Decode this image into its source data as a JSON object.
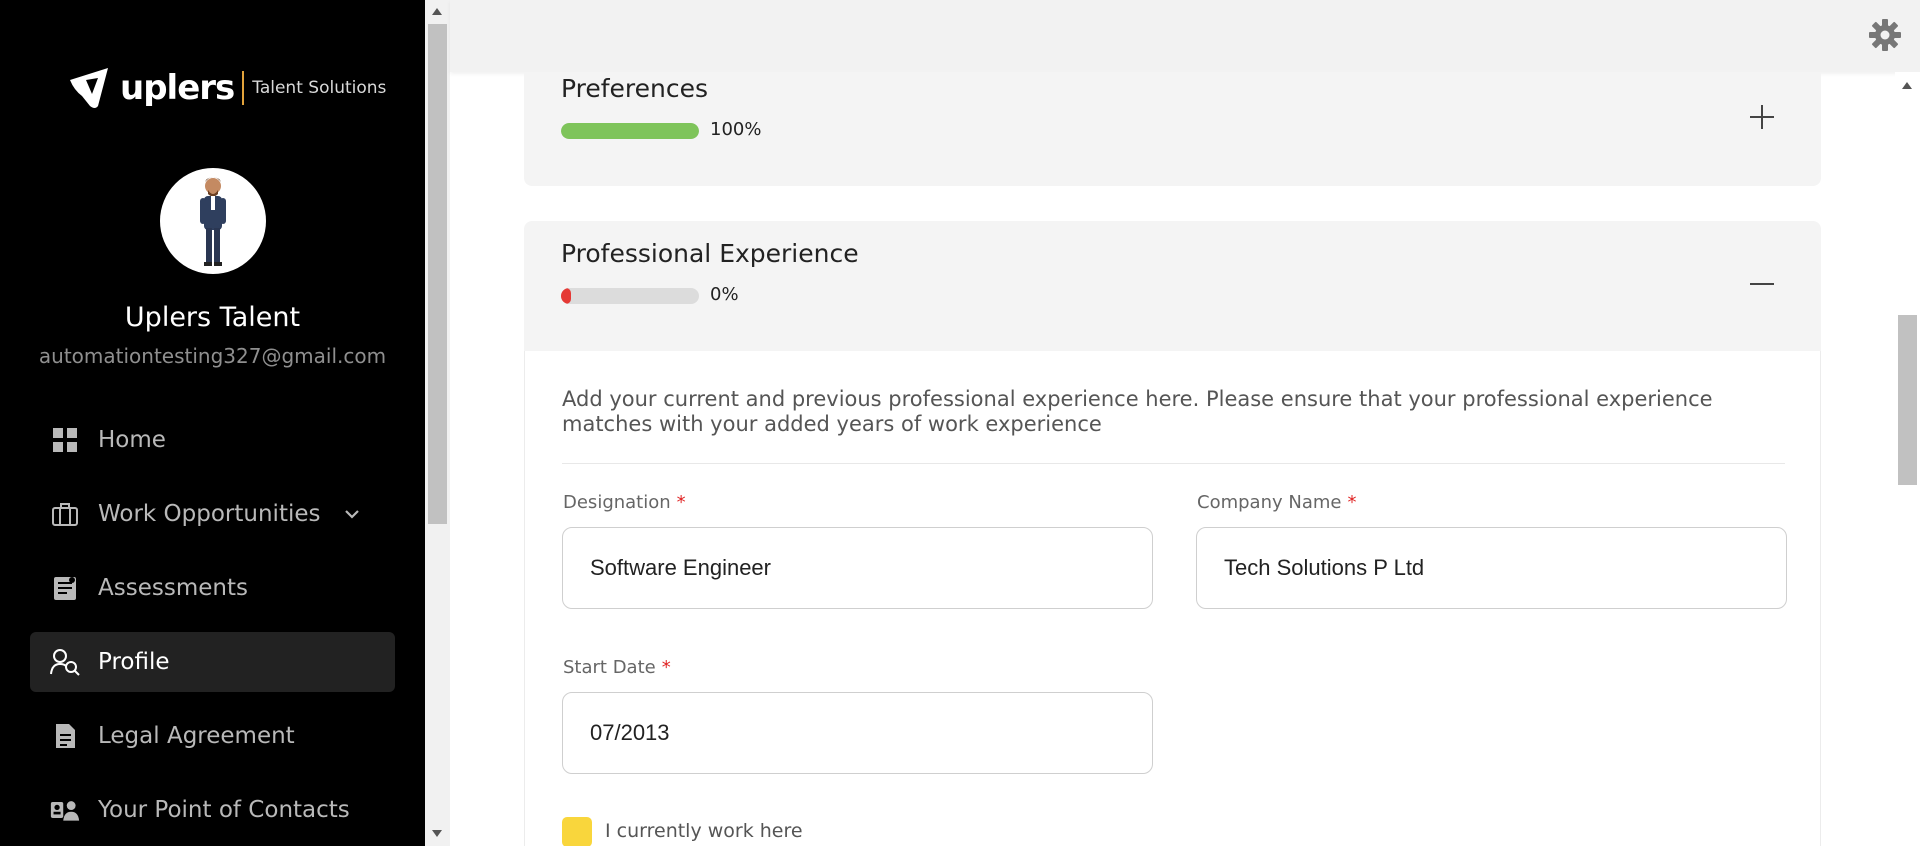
{
  "brand": {
    "name": "uplers",
    "tagline": "Talent Solutions",
    "accent": "#e2a33b"
  },
  "user": {
    "name": "Uplers Talent",
    "email": "automationtesting327@gmail.com"
  },
  "nav": [
    {
      "label": "Home",
      "icon": "grid-icon",
      "active": false
    },
    {
      "label": "Work Opportunities",
      "icon": "briefcase-icon",
      "active": false,
      "expandable": true
    },
    {
      "label": "Assessments",
      "icon": "assessment-icon",
      "active": false
    },
    {
      "label": "Profile",
      "icon": "profile-search-icon",
      "active": true
    },
    {
      "label": "Legal Agreement",
      "icon": "document-icon",
      "active": false
    },
    {
      "label": "Your Point of Contacts",
      "icon": "contacts-icon",
      "active": false
    }
  ],
  "sections": {
    "preferences": {
      "title": "Preferences",
      "progress": 100,
      "progress_label": "100%",
      "progress_color": "#7ec45a",
      "toggle": "plus-icon"
    },
    "experience": {
      "title": "Professional Experience",
      "progress": 0,
      "progress_label": "0%",
      "progress_color": "#e53935",
      "toggle": "minus-icon"
    }
  },
  "experience_form": {
    "description": "Add your current and previous professional experience here. Please ensure that your professional experience matches with your added years of work experience",
    "designation": {
      "label": "Designation",
      "required_mark": "*",
      "value": "Software Engineer"
    },
    "company": {
      "label": "Company Name",
      "required_mark": "*",
      "value": "Tech Solutions P Ltd"
    },
    "start_date": {
      "label": "Start Date",
      "required_mark": "*",
      "value": "07/2013"
    },
    "current_job": {
      "label": "I currently work here",
      "checked": false,
      "color": "#f9d63c"
    }
  }
}
